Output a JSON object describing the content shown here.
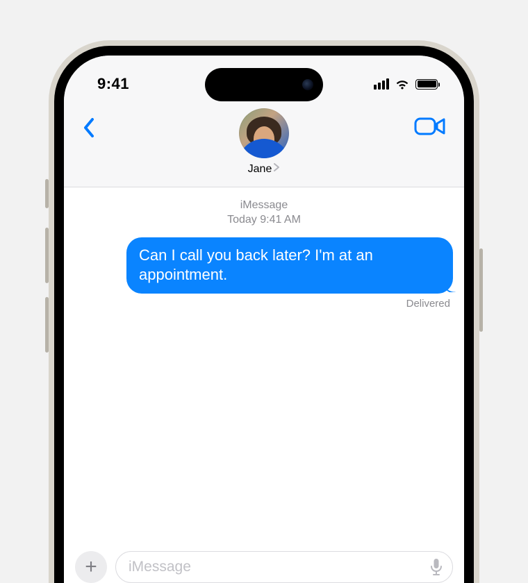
{
  "status": {
    "time": "9:41"
  },
  "header": {
    "contact_name": "Jane"
  },
  "thread": {
    "meta_line1": "iMessage",
    "meta_line2": "Today 9:41 AM",
    "messages": [
      {
        "text": "Can I call you back later? I'm at an appointment.",
        "status": "Delivered"
      }
    ]
  },
  "composer": {
    "placeholder": "iMessage"
  },
  "colors": {
    "accent": "#007aff",
    "bubble_sent": "#0a84ff"
  }
}
